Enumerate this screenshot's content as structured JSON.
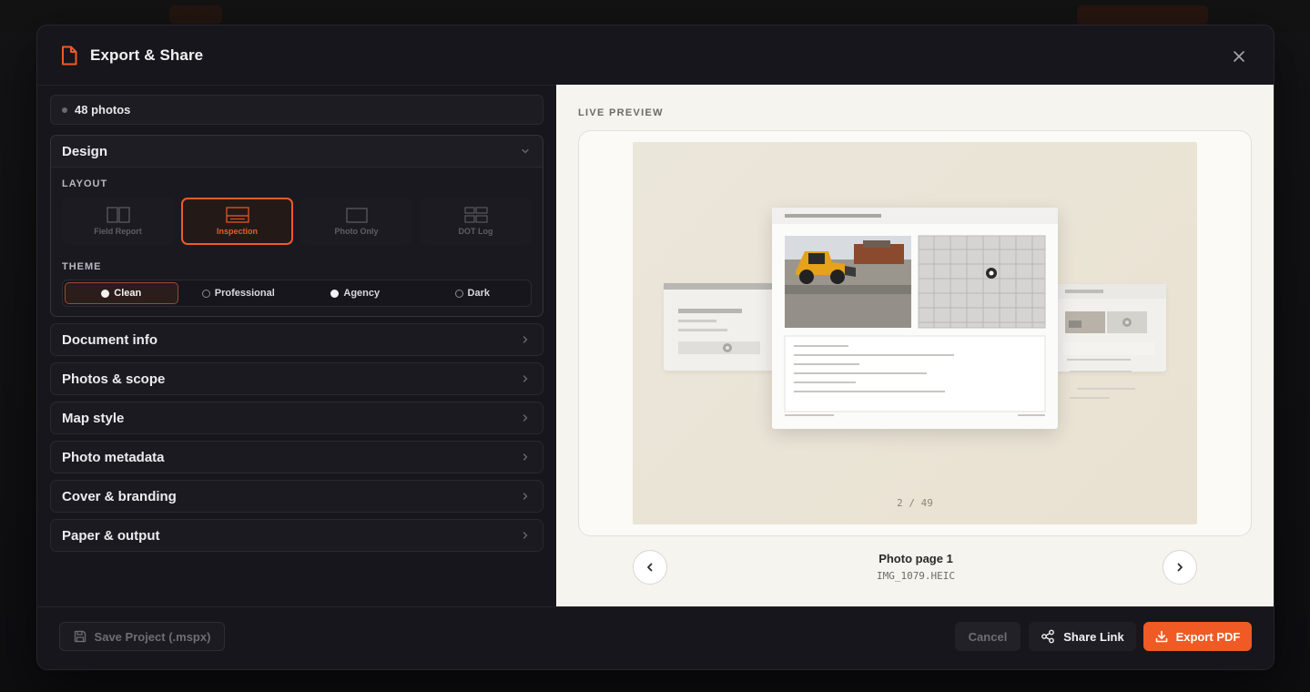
{
  "modal": {
    "title": "Export & Share",
    "icon": "document-icon",
    "accent": "#f05a24"
  },
  "left": {
    "photos_count": "48 photos",
    "design": {
      "title": "Design",
      "layout_label": "LAYOUT",
      "layouts": [
        {
          "label": "Field Report",
          "selected": false
        },
        {
          "label": "Inspection",
          "selected": true
        },
        {
          "label": "Photo Only",
          "selected": false
        },
        {
          "label": "DOT Log",
          "selected": false
        }
      ],
      "theme_label": "THEME",
      "themes": [
        {
          "label": "Clean",
          "selected": true
        },
        {
          "label": "Professional",
          "selected": false
        },
        {
          "label": "Agency",
          "selected": false
        },
        {
          "label": "Dark",
          "selected": false
        }
      ]
    },
    "sections": [
      "Document info",
      "Photos & scope",
      "Map style",
      "Photo metadata",
      "Cover & branding",
      "Paper & output"
    ]
  },
  "preview": {
    "label": "LIVE PREVIEW",
    "page_counter": "2 / 49",
    "page_title": "Photo page 1",
    "file_name": "IMG_1079.HEIC"
  },
  "footer": {
    "save_label": "Save Project (.mspx)",
    "cancel_label": "Cancel",
    "share_label": "Share Link",
    "export_label": "Export PDF"
  }
}
